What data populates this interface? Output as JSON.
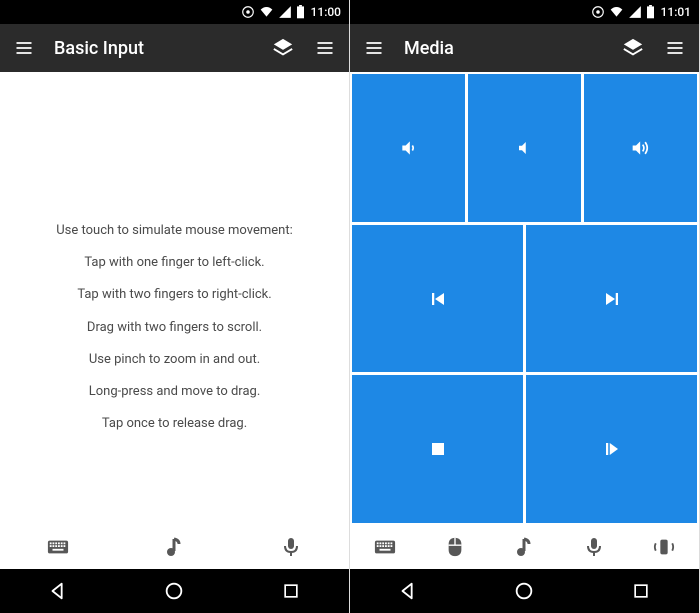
{
  "left": {
    "status": {
      "time": "11:00"
    },
    "appbar": {
      "title": "Basic Input"
    },
    "instructions": [
      "Use touch to simulate mouse movement:",
      "Tap with one finger to left-click.",
      "Tap with two fingers to right-click.",
      "Drag with two fingers to scroll.",
      "Use pinch to zoom in and out.",
      "Long-press and move to drag.",
      "Tap once to release drag."
    ],
    "bottom_icons": [
      "keyboard",
      "music",
      "mic"
    ]
  },
  "right": {
    "status": {
      "time": "11:01"
    },
    "appbar": {
      "title": "Media"
    },
    "media_buttons": {
      "row1": [
        "volume-down",
        "volume-mute",
        "volume-up"
      ],
      "row2": [
        "previous-track",
        "next-track"
      ],
      "row3": [
        "stop",
        "play"
      ]
    },
    "bottom_icons": [
      "keyboard",
      "mouse",
      "music",
      "mic",
      "phone-ring"
    ]
  },
  "colors": {
    "media_tile": "#1e88e5",
    "appbar_bg": "#2b2b2b"
  }
}
